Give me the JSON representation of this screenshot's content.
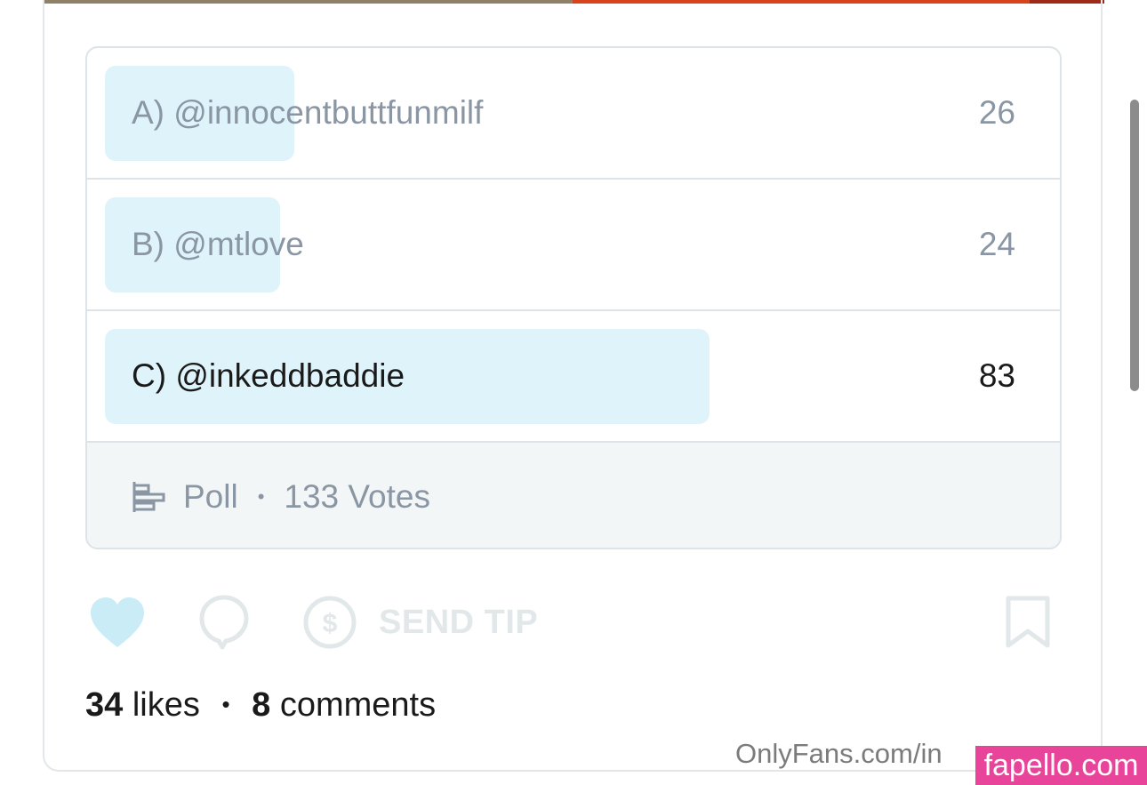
{
  "poll": {
    "options": [
      {
        "label": "A) @innocentbuttfunmilf",
        "votes": "26",
        "share": 0.195
      },
      {
        "label": "B) @mtlove",
        "votes": "24",
        "share": 0.18
      },
      {
        "label": "C) @inkeddbaddie",
        "votes": "83",
        "share": 0.624
      }
    ],
    "footer": {
      "label": "Poll",
      "separator": "•",
      "votes_text": "133 Votes",
      "icon": "poll-icon"
    }
  },
  "actions": {
    "like_icon": "heart-icon",
    "comment_icon": "comment-icon",
    "tip_icon": "dollar-coin-icon",
    "tip_label": "SEND TIP",
    "bookmark_icon": "bookmark-icon"
  },
  "stats": {
    "likes_count": "34",
    "likes_label": "likes",
    "separator": "•",
    "comments_count": "8",
    "comments_label": "comments"
  },
  "watermark": {
    "url_text": "OnlyFans.com/in",
    "badge_text": "fapello.com"
  },
  "colors": {
    "accent_light": "#dff3fb",
    "like_heart": "#c9ecf6",
    "muted_text": "#8a96a3",
    "badge": "#e8449a"
  }
}
